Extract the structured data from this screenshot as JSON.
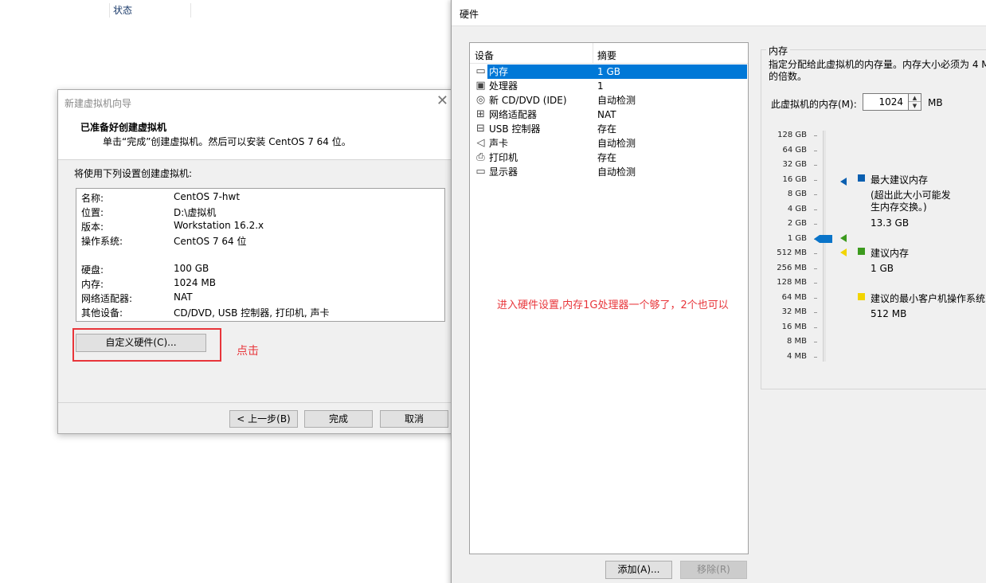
{
  "background": {
    "column_status": "状态"
  },
  "wizard": {
    "title": "新建虚拟机向导",
    "heading": "已准备好创建虚拟机",
    "subheading": "单击“完成”创建虚拟机。然后可以安装 CentOS 7 64 位。",
    "intro": "将使用下列设置创建虚拟机:",
    "summary": [
      {
        "key": "名称:",
        "value": "CentOS 7-hwt"
      },
      {
        "key": "位置:",
        "value": "D:\\虚拟机"
      },
      {
        "key": "版本:",
        "value": "Workstation 16.2.x"
      },
      {
        "key": "操作系统:",
        "value": "CentOS 7 64 位"
      },
      {
        "key": "硬盘:",
        "value": "100 GB"
      },
      {
        "key": "内存:",
        "value": "1024 MB"
      },
      {
        "key": "网络适配器:",
        "value": "NAT"
      },
      {
        "key": "其他设备:",
        "value": "CD/DVD, USB 控制器, 打印机, 声卡"
      }
    ],
    "custom_hardware_label": "自定义硬件(C)...",
    "back_label": "< 上一步(B)",
    "finish_label": "完成",
    "cancel_label": "取消"
  },
  "annotations": {
    "click": "点击",
    "note": "进入硬件设置,内存1G处理器一个够了，2个也可以"
  },
  "hardware": {
    "title": "硬件",
    "col_device": "设备",
    "col_summary": "摘要",
    "devices": [
      {
        "name": "内存",
        "summary": "1 GB",
        "icon": "memory-icon",
        "glyph": "▭",
        "selected": true
      },
      {
        "name": "处理器",
        "summary": "1",
        "icon": "processor-icon",
        "glyph": "▣",
        "selected": false
      },
      {
        "name": "新 CD/DVD (IDE)",
        "summary": "自动检测",
        "icon": "cd-dvd-icon",
        "glyph": "◎",
        "selected": false
      },
      {
        "name": "网络适配器",
        "summary": "NAT",
        "icon": "network-adapter-icon",
        "glyph": "⊞",
        "selected": false
      },
      {
        "name": "USB 控制器",
        "summary": "存在",
        "icon": "usb-controller-icon",
        "glyph": "⊟",
        "selected": false
      },
      {
        "name": "声卡",
        "summary": "自动检测",
        "icon": "sound-card-icon",
        "glyph": "◁",
        "selected": false
      },
      {
        "name": "打印机",
        "summary": "存在",
        "icon": "printer-icon",
        "glyph": "⎙",
        "selected": false
      },
      {
        "name": "显示器",
        "summary": "自动检测",
        "icon": "display-icon",
        "glyph": "▭",
        "selected": false
      }
    ],
    "add_label": "添加(A)...",
    "remove_label": "移除(R)",
    "memory": {
      "group_title": "内存",
      "description": "指定分配给此虚拟机的内存量。内存大小必须为 4 M 的倍数。",
      "field_label": "此虚拟机的内存(M):",
      "value": "1024",
      "unit": "MB",
      "scale": [
        "128 GB",
        "64 GB",
        "32 GB",
        "16 GB",
        "8 GB",
        "4 GB",
        "2 GB",
        "1 GB",
        "512 MB",
        "256 MB",
        "128 MB",
        "64 MB",
        "32 MB",
        "16 MB",
        "8 MB",
        "4 MB"
      ],
      "selected_scale": "1 GB",
      "max_recommended_title": "最大建议内存",
      "max_recommended_note": "(超出此大小可能发生内存交换。)",
      "max_recommended_value": "13.3 GB",
      "recommended_title": "建议内存",
      "recommended_value": "1 GB",
      "min_guest_title": "建议的最小客户机操作系统",
      "min_guest_value": "512 MB",
      "colors": {
        "max": "#0a5fb0",
        "recommended": "#3c9a1e",
        "min": "#f2d400",
        "slider": "#0a74c9"
      }
    }
  }
}
